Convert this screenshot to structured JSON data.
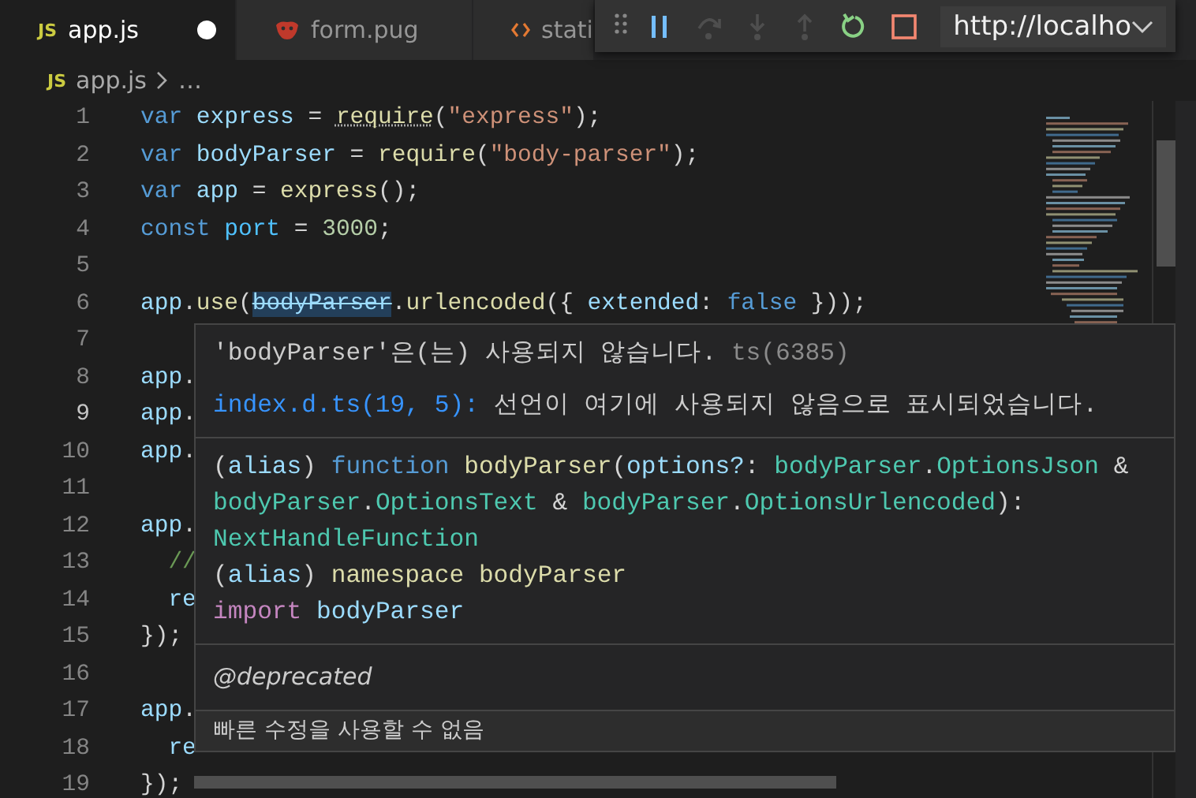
{
  "tabs": [
    {
      "kind": "js",
      "icon_text": "JS",
      "label": "app.js",
      "selected": true,
      "modified": true
    },
    {
      "kind": "pug",
      "label": "form.pug",
      "selected": false,
      "modified": false
    },
    {
      "kind": "html",
      "label": "stati",
      "selected": false,
      "modified": false
    }
  ],
  "debug_toolbar": {
    "buttons": [
      {
        "kind": "grip"
      },
      {
        "kind": "pause",
        "disabled": false
      },
      {
        "kind": "step-over",
        "disabled": true
      },
      {
        "kind": "step-into",
        "disabled": true
      },
      {
        "kind": "step-out",
        "disabled": true
      },
      {
        "kind": "restart",
        "disabled": false
      },
      {
        "kind": "stop",
        "disabled": false
      }
    ],
    "target": "http://localho"
  },
  "breadcrumb": {
    "icon_text": "JS",
    "file": "app.js",
    "rest": "…"
  },
  "code_lines": [
    {
      "number": "1",
      "current": false,
      "tokens": [
        {
          "kind": "keyword",
          "text": "var"
        },
        {
          "kind": "variable",
          "text": " express"
        },
        {
          "kind": "plain",
          "text": " = "
        },
        {
          "kind": "hinted",
          "text": "require"
        },
        {
          "kind": "plain",
          "text": "("
        },
        {
          "kind": "string",
          "text": "\"express\""
        },
        {
          "kind": "plain",
          "text": ");"
        }
      ]
    },
    {
      "number": "2",
      "current": false,
      "tokens": [
        {
          "kind": "keyword",
          "text": "var"
        },
        {
          "kind": "variable",
          "text": " bodyParser"
        },
        {
          "kind": "plain",
          "text": " = "
        },
        {
          "kind": "function",
          "text": "require"
        },
        {
          "kind": "plain",
          "text": "("
        },
        {
          "kind": "string",
          "text": "\"body-parser\""
        },
        {
          "kind": "plain",
          "text": ");"
        }
      ]
    },
    {
      "number": "3",
      "current": false,
      "tokens": [
        {
          "kind": "keyword",
          "text": "var"
        },
        {
          "kind": "variable",
          "text": " app"
        },
        {
          "kind": "plain",
          "text": " = "
        },
        {
          "kind": "function",
          "text": "express"
        },
        {
          "kind": "plain",
          "text": "();"
        }
      ]
    },
    {
      "number": "4",
      "current": false,
      "tokens": [
        {
          "kind": "keyword",
          "text": "const"
        },
        {
          "kind": "constant",
          "text": " port"
        },
        {
          "kind": "plain",
          "text": " = "
        },
        {
          "kind": "number",
          "text": "3000"
        },
        {
          "kind": "plain",
          "text": ";"
        }
      ]
    },
    {
      "number": "5",
      "current": false
    },
    {
      "number": "6",
      "current": false,
      "tokens": [
        {
          "kind": "variable",
          "text": "app"
        },
        {
          "kind": "plain",
          "text": "."
        },
        {
          "kind": "function",
          "text": "use"
        },
        {
          "kind": "plain",
          "text": "("
        },
        {
          "kind": "deprecated",
          "text": "bodyParser"
        },
        {
          "kind": "plain",
          "text": "."
        },
        {
          "kind": "function",
          "text": "urlencoded"
        },
        {
          "kind": "plain",
          "text": "({ "
        },
        {
          "kind": "variable",
          "text": "extended"
        },
        {
          "kind": "plain",
          "text": ": "
        },
        {
          "kind": "keyword",
          "text": "false"
        },
        {
          "kind": "plain",
          "text": " }));"
        }
      ]
    },
    {
      "number": "7",
      "current": false
    },
    {
      "number": "8",
      "current": false,
      "tokens": [
        {
          "kind": "variable",
          "text": "app"
        },
        {
          "kind": "plain",
          "text": "."
        }
      ]
    },
    {
      "number": "9",
      "current": true,
      "tokens": [
        {
          "kind": "variable",
          "text": "app"
        },
        {
          "kind": "plain",
          "text": "."
        }
      ]
    },
    {
      "number": "10",
      "current": false,
      "tokens": [
        {
          "kind": "variable",
          "text": "app"
        },
        {
          "kind": "plain",
          "text": "."
        }
      ]
    },
    {
      "number": "11",
      "current": false
    },
    {
      "number": "12",
      "current": false,
      "tokens": [
        {
          "kind": "variable",
          "text": "app"
        },
        {
          "kind": "plain",
          "text": "."
        }
      ]
    },
    {
      "number": "13",
      "current": false,
      "tokens": [
        {
          "kind": "comment",
          "text": "  //"
        }
      ]
    },
    {
      "number": "14",
      "current": false,
      "tokens": [
        {
          "kind": "variable",
          "text": "  re"
        }
      ]
    },
    {
      "number": "15",
      "current": false,
      "tokens": [
        {
          "kind": "plain",
          "text": "});"
        }
      ]
    },
    {
      "number": "16",
      "current": false
    },
    {
      "number": "17",
      "current": false,
      "tokens": [
        {
          "kind": "variable",
          "text": "app"
        },
        {
          "kind": "plain",
          "text": "."
        }
      ]
    },
    {
      "number": "18",
      "current": false,
      "tokens": [
        {
          "kind": "variable",
          "text": "  re"
        }
      ]
    },
    {
      "number": "19",
      "current": false,
      "tokens": [
        {
          "kind": "plain",
          "text": "});"
        }
      ]
    }
  ],
  "hover": {
    "message": {
      "text": "'bodyParser'은(는) 사용되지 않습니다.",
      "code": "ts(6385)"
    },
    "related": {
      "link": "index.d.ts(19, 5):",
      "text": "선언이 여기에 사용되지 않음으로 표시되었습니다."
    },
    "signature_lines": [
      [
        {
          "kind": "plain",
          "text": "("
        },
        {
          "kind": "variable",
          "text": "alias"
        },
        {
          "kind": "plain",
          "text": ") "
        },
        {
          "kind": "keyword",
          "text": "function"
        },
        {
          "kind": "function",
          "text": " bodyParser"
        },
        {
          "kind": "plain",
          "text": "("
        },
        {
          "kind": "variable",
          "text": "options?"
        },
        {
          "kind": "plain",
          "text": ": "
        },
        {
          "kind": "type",
          "text": "bodyParser"
        },
        {
          "kind": "plain",
          "text": "."
        },
        {
          "kind": "type",
          "text": "OptionsJson"
        },
        {
          "kind": "plain",
          "text": " &"
        }
      ],
      [
        {
          "kind": "type",
          "text": "bodyParser"
        },
        {
          "kind": "plain",
          "text": "."
        },
        {
          "kind": "type",
          "text": "OptionsText"
        },
        {
          "kind": "plain",
          "text": " & "
        },
        {
          "kind": "type",
          "text": "bodyParser"
        },
        {
          "kind": "plain",
          "text": "."
        },
        {
          "kind": "type",
          "text": "OptionsUrlencoded"
        },
        {
          "kind": "plain",
          "text": "):"
        }
      ],
      [
        {
          "kind": "type",
          "text": "NextHandleFunction"
        }
      ],
      [
        {
          "kind": "plain",
          "text": "("
        },
        {
          "kind": "variable",
          "text": "alias"
        },
        {
          "kind": "plain",
          "text": ") "
        },
        {
          "kind": "function",
          "text": "namespace bodyParser"
        }
      ],
      [
        {
          "kind": "import",
          "text": "import"
        },
        {
          "kind": "variable",
          "text": " bodyParser"
        }
      ]
    ],
    "tag": "@deprecated",
    "status": "빠른 수정을 사용할 수 없음"
  }
}
